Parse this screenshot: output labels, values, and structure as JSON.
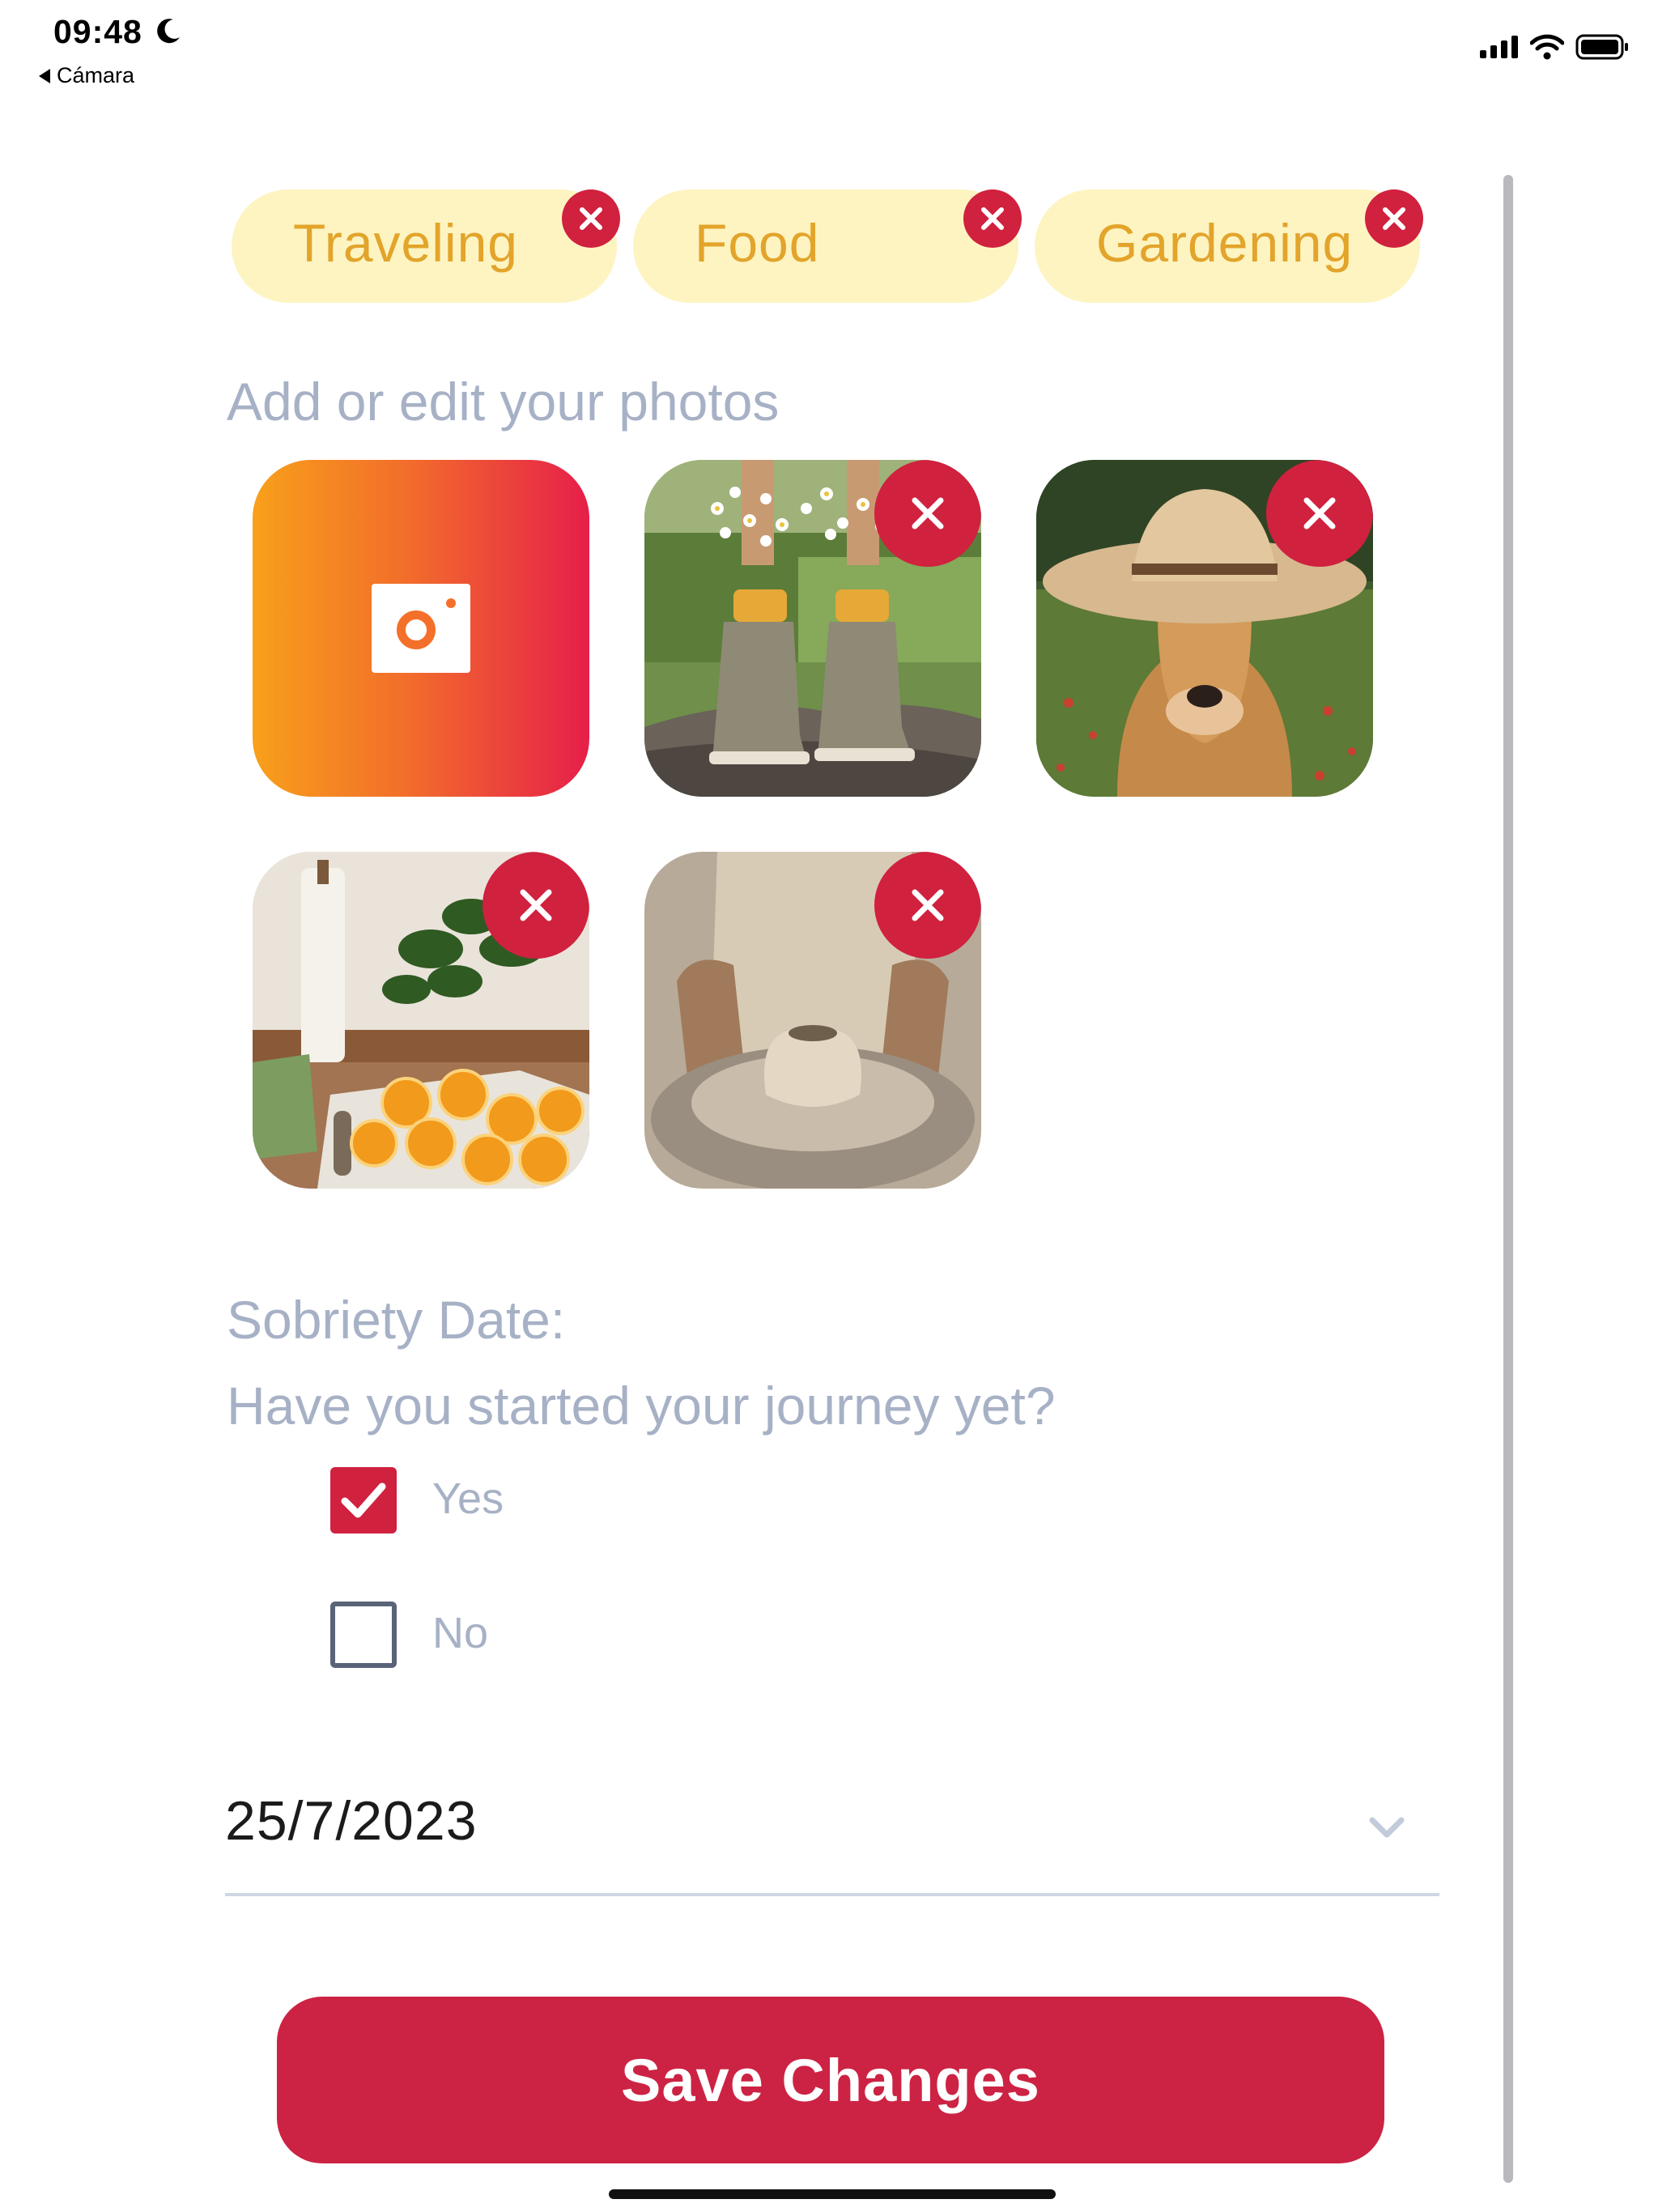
{
  "status_bar": {
    "time": "09:48",
    "back_label": "Cámara"
  },
  "chips": [
    {
      "label": "Traveling"
    },
    {
      "label": "Food"
    },
    {
      "label": "Gardening"
    }
  ],
  "photos": {
    "title": "Add or edit your photos",
    "items": [
      {
        "subject": "boots with flowers"
      },
      {
        "subject": "dog in cowboy hat"
      },
      {
        "subject": "oranges and kitchen plants"
      },
      {
        "subject": "pottery wheel"
      }
    ]
  },
  "sobriety": {
    "label": "Sobriety Date:",
    "question": "Have you started your journey yet?",
    "options": [
      {
        "label": "Yes",
        "checked": true
      },
      {
        "label": "No",
        "checked": false
      }
    ],
    "date": "25/7/2023"
  },
  "save_label": "Save Changes",
  "colors": {
    "accent": "#d0213f",
    "chip_bg": "#fdf4c1",
    "chip_text": "#e3a42b",
    "muted_text": "#a7b1c6"
  }
}
